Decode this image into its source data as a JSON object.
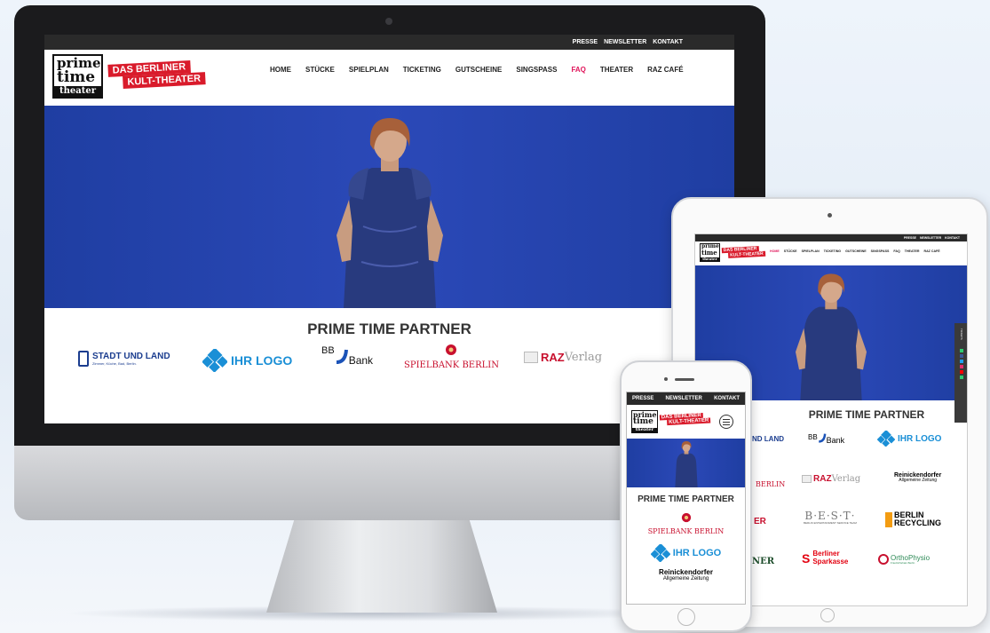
{
  "site": {
    "top_links": [
      "PRESSE",
      "NEWSLETTER",
      "KONTAKT"
    ],
    "nav": [
      "HOME",
      "STÜCKE",
      "SPIELPLAN",
      "TICKETING",
      "GUTSCHEINE",
      "SINGSPASS",
      "FAQ",
      "THEATER",
      "RAZ CAFÉ"
    ],
    "logo_lines": [
      "prime",
      "time",
      "theater"
    ],
    "tagline": [
      "DAS BERLINER",
      "KULT-THEATER"
    ],
    "partner_title": "PRIME TIME PARTNER"
  },
  "desktop": {
    "active_nav": "FAQ",
    "partners": {
      "stadt": {
        "name": "STADT UND LAND",
        "sub": "Zimmer, Küche, Bad, Berlin."
      },
      "ihr": {
        "name": "IHR LOGO"
      },
      "bb": {
        "top": "BB",
        "name": "Bank"
      },
      "spielbank": {
        "name": "SPIELBANK BERLIN"
      },
      "raz": {
        "bold": "RAZ",
        "light": "Verlag"
      }
    }
  },
  "tablet": {
    "active_nav": "HOME",
    "partners": {
      "r1": {
        "stadt": "ND LAND",
        "bb_top": "BB",
        "bb": "Bank",
        "ihr": "IHR LOGO"
      },
      "r2": {
        "spiel": "BERLIN",
        "raz_bold": "RAZ",
        "raz_light": "Verlag",
        "rz1": "Reinickendorfer",
        "rz2": "Allgemeine Zeitung"
      },
      "r3": {
        "partial": "ER",
        "best": "B·E·S·T·",
        "best_sub": "BERLIN ENTERTAINMENT SERVICE TEAM",
        "recyc1": "BERLIN",
        "recyc2": "RECYCLING"
      },
      "r4": {
        "partial": "NER",
        "spk1": "Berliner",
        "spk2": "Sparkasse",
        "ortho1": "Ortho",
        "ortho2": "Physio",
        "ortho_sub": "Friedrichshain Berlin"
      }
    },
    "side_tab": "TICKETS"
  },
  "phone": {
    "top_links": [
      "PRESSE",
      "NEWSLETTER",
      "KONTAKT"
    ],
    "partners": {
      "spielbank": "SPIELBANK BERLIN",
      "ihr": "IHR LOGO",
      "rz1": "Reinickendorfer",
      "rz2": "Allgemeine Zeitung"
    }
  },
  "colors": {
    "accent": "#e0145a",
    "hero_blue": "#2341ad",
    "tag_red": "#d91b2b",
    "spielbank_red": "#c8102e",
    "ihr_logo_blue": "#1a8fd6"
  }
}
